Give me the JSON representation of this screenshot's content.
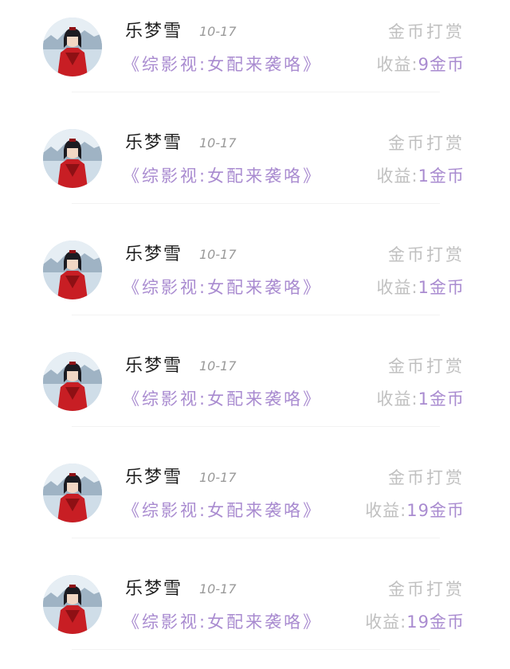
{
  "colors": {
    "accent_purple": "#a98bd0",
    "muted_gray": "#c0c0c0",
    "name_black": "#1f1f1f",
    "date_gray": "#9a9a9a"
  },
  "rows": [
    {
      "name": "乐梦雪",
      "date": "10-17",
      "title": "《综影视:女配来袭咯》",
      "reward_label": "金币打赏",
      "income_label": "收益:",
      "income_value": "9金币"
    },
    {
      "name": "乐梦雪",
      "date": "10-17",
      "title": "《综影视:女配来袭咯》",
      "reward_label": "金币打赏",
      "income_label": "收益:",
      "income_value": "1金币"
    },
    {
      "name": "乐梦雪",
      "date": "10-17",
      "title": "《综影视:女配来袭咯》",
      "reward_label": "金币打赏",
      "income_label": "收益:",
      "income_value": "1金币"
    },
    {
      "name": "乐梦雪",
      "date": "10-17",
      "title": "《综影视:女配来袭咯》",
      "reward_label": "金币打赏",
      "income_label": "收益:",
      "income_value": "1金币"
    },
    {
      "name": "乐梦雪",
      "date": "10-17",
      "title": "《综影视:女配来袭咯》",
      "reward_label": "金币打赏",
      "income_label": "收益:",
      "income_value": "19金币"
    },
    {
      "name": "乐梦雪",
      "date": "10-17",
      "title": "《综影视:女配来袭咯》",
      "reward_label": "金币打赏",
      "income_label": "收益:",
      "income_value": "19金币"
    }
  ]
}
